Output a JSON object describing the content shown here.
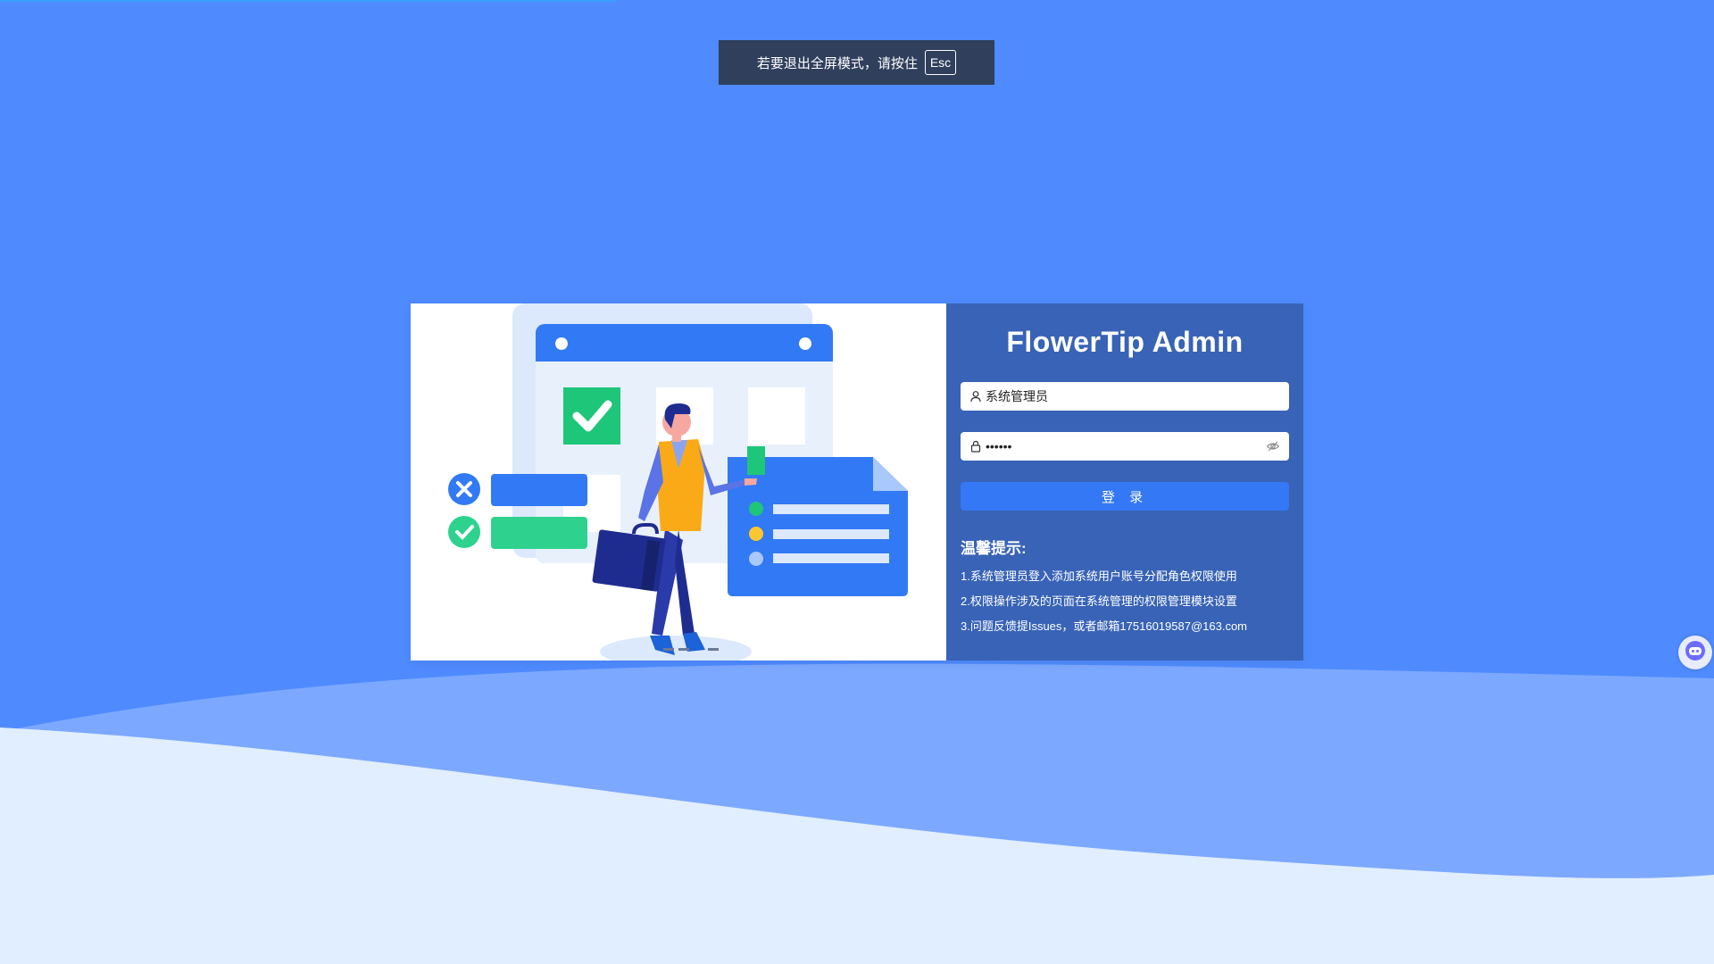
{
  "fullscreen_notice": {
    "text": "若要退出全屏模式，请按住",
    "key": "Esc"
  },
  "login": {
    "title": "FlowerTip Admin",
    "username": "系统管理员",
    "password_mask": "••••••",
    "submit_label": "登 录"
  },
  "tips": {
    "title": "温馨提示:",
    "items": [
      "1.系统管理员登入添加系统用户账号分配角色权限使用",
      "2.权限操作涉及的页面在系统管理的权限管理模块设置",
      "3.问题反馈提Issues，或者邮箱17516019587@163.com"
    ]
  },
  "colors": {
    "background": "#4f8bff",
    "form_panel": "#3863b6",
    "button": "#3478f6",
    "wave_light": "#e1eeff",
    "wave_mid": "#7ca8ff"
  },
  "icons": [
    "user-icon",
    "lock-icon",
    "eye-off-icon",
    "check-icon",
    "close-icon",
    "assistant-bot-icon"
  ]
}
